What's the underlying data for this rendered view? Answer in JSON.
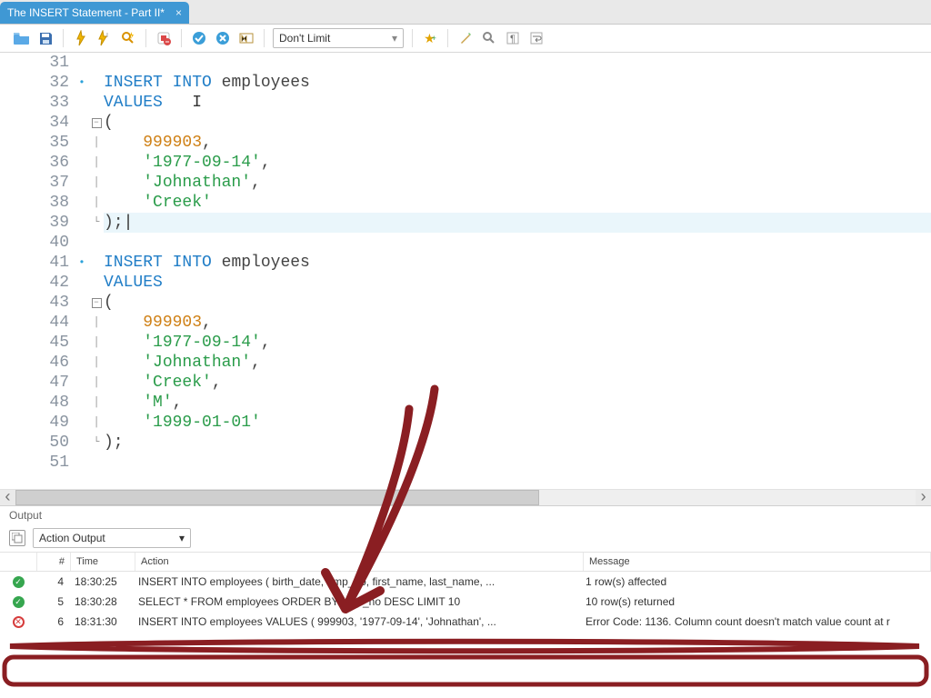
{
  "tab": {
    "title": "The INSERT Statement - Part II*"
  },
  "toolbar": {
    "limit_label": "Don't Limit"
  },
  "editor": {
    "lines": [
      {
        "n": "31",
        "mark": "",
        "fold": "",
        "html": ""
      },
      {
        "n": "32",
        "mark": "•",
        "fold": "",
        "html": "<span class='kw'>INSERT INTO</span> <span class='id'>employees</span>"
      },
      {
        "n": "33",
        "mark": "",
        "fold": "",
        "html": "<span class='kw'>VALUES</span>   <span class='caret'>I</span>"
      },
      {
        "n": "34",
        "mark": "",
        "fold": "box",
        "html": "<span class='pn'>(</span>"
      },
      {
        "n": "35",
        "mark": "",
        "fold": "pipe",
        "html": "    <span class='num'>999903</span><span class='pn'>,</span>"
      },
      {
        "n": "36",
        "mark": "",
        "fold": "pipe",
        "html": "    <span class='str'>'1977-09-14'</span><span class='pn'>,</span>"
      },
      {
        "n": "37",
        "mark": "",
        "fold": "pipe",
        "html": "    <span class='str'>'Johnathan'</span><span class='pn'>,</span>"
      },
      {
        "n": "38",
        "mark": "",
        "fold": "pipe",
        "html": "    <span class='str'>'Creek'</span>"
      },
      {
        "n": "39",
        "mark": "",
        "fold": "end",
        "html": "<span class='pn'>);</span><span class='caret'>|</span>",
        "hl": true
      },
      {
        "n": "40",
        "mark": "",
        "fold": "",
        "html": ""
      },
      {
        "n": "41",
        "mark": "•",
        "fold": "",
        "html": "<span class='kw'>INSERT INTO</span> <span class='id'>employees</span>"
      },
      {
        "n": "42",
        "mark": "",
        "fold": "",
        "html": "<span class='kw'>VALUES</span>"
      },
      {
        "n": "43",
        "mark": "",
        "fold": "box",
        "html": "<span class='pn'>(</span>"
      },
      {
        "n": "44",
        "mark": "",
        "fold": "pipe",
        "html": "    <span class='num'>999903</span><span class='pn'>,</span>"
      },
      {
        "n": "45",
        "mark": "",
        "fold": "pipe",
        "html": "    <span class='str'>'1977-09-14'</span><span class='pn'>,</span>"
      },
      {
        "n": "46",
        "mark": "",
        "fold": "pipe",
        "html": "    <span class='str'>'Johnathan'</span><span class='pn'>,</span>"
      },
      {
        "n": "47",
        "mark": "",
        "fold": "pipe",
        "html": "    <span class='str'>'Creek'</span><span class='pn'>,</span>"
      },
      {
        "n": "48",
        "mark": "",
        "fold": "pipe",
        "html": "    <span class='str'>'M'</span><span class='pn'>,</span>"
      },
      {
        "n": "49",
        "mark": "",
        "fold": "pipe",
        "html": "    <span class='str'>'1999-01-01'</span>"
      },
      {
        "n": "50",
        "mark": "",
        "fold": "end",
        "html": "<span class='pn'>);</span>"
      },
      {
        "n": "51",
        "mark": "",
        "fold": "",
        "html": ""
      }
    ]
  },
  "output": {
    "title": "Output",
    "mode": "Action Output",
    "headers": {
      "num": "#",
      "time": "Time",
      "action": "Action",
      "message": "Message"
    },
    "rows": [
      {
        "status": "ok",
        "num": "4",
        "time": "18:30:25",
        "action": "INSERT INTO employees ( birth_date,    emp_no,    first_name,    last_name,    ...",
        "message": "1 row(s) affected"
      },
      {
        "status": "ok",
        "num": "5",
        "time": "18:30:28",
        "action": "SELECT    * FROM    employees ORDER BY emp_no DESC LIMIT 10",
        "message": "10 row(s) returned"
      },
      {
        "status": "err",
        "num": "6",
        "time": "18:31:30",
        "action": "INSERT INTO employees VALUES ( 999903,    '1977-09-14',    'Johnathan',    ...",
        "message": "Error Code: 1136. Column count doesn't match value count at r"
      }
    ]
  }
}
